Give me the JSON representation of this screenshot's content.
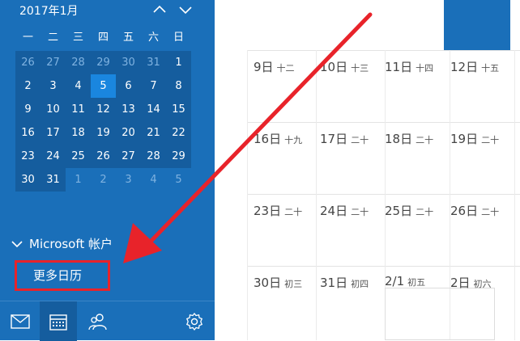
{
  "calendar": {
    "month_title": "2017年1月",
    "weekdays": [
      "一",
      "二",
      "三",
      "四",
      "五",
      "六",
      "日"
    ],
    "weeks": [
      [
        "26",
        "27",
        "28",
        "29",
        "30",
        "31",
        "1"
      ],
      [
        "2",
        "3",
        "4",
        "5",
        "6",
        "7",
        "8"
      ],
      [
        "9",
        "10",
        "11",
        "12",
        "13",
        "14",
        "15"
      ],
      [
        "16",
        "17",
        "18",
        "19",
        "20",
        "21",
        "22"
      ],
      [
        "23",
        "24",
        "25",
        "26",
        "27",
        "28",
        "29"
      ],
      [
        "30",
        "31",
        "1",
        "2",
        "3",
        "4",
        "5"
      ]
    ],
    "today": "5"
  },
  "accounts": {
    "section_label": "Microsoft 帐户",
    "more_calendars": "更多日历"
  },
  "bottom_nav": {
    "icons": [
      "mail-icon",
      "calendar-icon",
      "people-icon",
      "settings-icon"
    ]
  },
  "grid": {
    "rows": [
      [
        {
          "day": "9日",
          "lunar": "十二"
        },
        {
          "day": "10日",
          "lunar": "十三"
        },
        {
          "day": "11日",
          "lunar": "十四"
        },
        {
          "day": "12日",
          "lunar": "十五"
        }
      ],
      [
        {
          "day": "16日",
          "lunar": "十九"
        },
        {
          "day": "17日",
          "lunar": "二十"
        },
        {
          "day": "18日",
          "lunar": "二十"
        },
        {
          "day": "19日",
          "lunar": "二十"
        }
      ],
      [
        {
          "day": "23日",
          "lunar": "二十"
        },
        {
          "day": "24日",
          "lunar": "二十"
        },
        {
          "day": "25日",
          "lunar": "二十"
        },
        {
          "day": "26日",
          "lunar": "二十"
        }
      ],
      [
        {
          "day": "30日",
          "lunar": "初三"
        },
        {
          "day": "31日",
          "lunar": "初四"
        },
        {
          "day": "2/1",
          "lunar": "初五"
        },
        {
          "day": "2日",
          "lunar": "初六"
        }
      ]
    ]
  },
  "colors": {
    "sidebar": "#1a6fb9",
    "today": "#1a86df",
    "highlight": "#e8232a"
  }
}
